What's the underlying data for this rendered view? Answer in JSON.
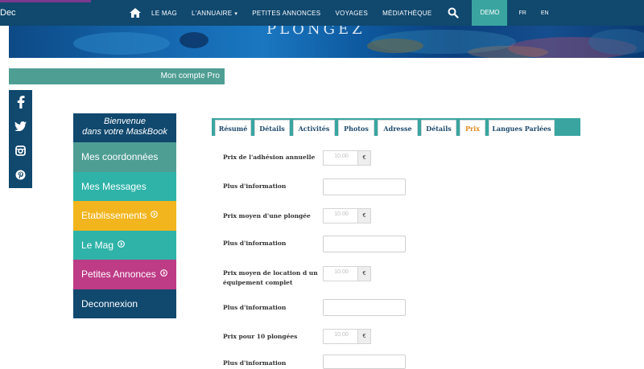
{
  "header": {
    "deconnexion_short": "Dec",
    "nav": [
      {
        "label": "LE MAG"
      },
      {
        "label": "L'ANNUAIRE",
        "caret": "▾"
      },
      {
        "label": "PETITES ANNONCES"
      },
      {
        "label": "VOYAGES"
      },
      {
        "label": "MÉDIATHÈQUE"
      }
    ],
    "demo_label": "DEMO",
    "languages": [
      "FR",
      "EN"
    ]
  },
  "hero": {
    "logo_text": "PLONGEZ"
  },
  "compte_pro": "Mon compte Pro",
  "sidebar": {
    "welcome_line1": "Bienvenue",
    "welcome_line2": "dans votre MaskBook",
    "items": [
      {
        "label": "Mes coordonnées",
        "color": "#4f9e94"
      },
      {
        "label": "Mes Messages",
        "color": "#2fb3a8"
      },
      {
        "label": "Etablissements",
        "color": "#f2b51d",
        "icon": "arrow-circle-icon"
      },
      {
        "label": "Le Mag",
        "color": "#2fb3a8",
        "icon": "arrow-circle-icon"
      },
      {
        "label": "Petites Annonces",
        "color": "#be3b86",
        "icon": "arrow-circle-icon"
      },
      {
        "label": "Deconnexion",
        "color": "#10486e"
      }
    ]
  },
  "tabs": [
    {
      "label": "Résumé"
    },
    {
      "label": "Détails"
    },
    {
      "label": "Activités"
    },
    {
      "label": "Photos"
    },
    {
      "label": "Adresse"
    },
    {
      "label": "Détails"
    },
    {
      "label": "Prix",
      "active": true
    },
    {
      "label": "Langues Parlées"
    }
  ],
  "form": {
    "prices": [
      {
        "label": "Prix de l'adhésion annuelle",
        "value": "10.00",
        "currency": "€"
      },
      {
        "label": "Prix moyen d'une plongée",
        "value": "10.00",
        "currency": "€"
      },
      {
        "label": "Prix moyen de location d un équipement complet",
        "value": "10.00",
        "currency": "€"
      },
      {
        "label": "Prix pour 10 plongées",
        "value": "10.00",
        "currency": "€"
      }
    ],
    "info_label": "Plus d'information"
  },
  "colors": {
    "nav_bg": "#10486e",
    "teal": "#3aa5a0",
    "active_tab": "#e08a1e"
  }
}
